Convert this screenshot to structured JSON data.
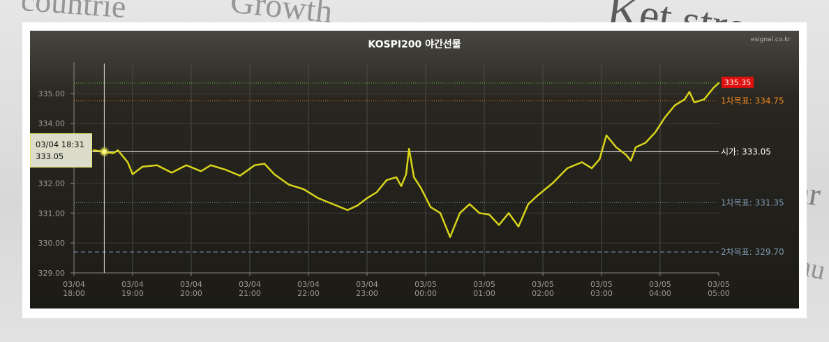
{
  "background_words": [
    "countrie",
    "Growth",
    "Ket stre",
    "ar",
    "au"
  ],
  "title": "KOSPI200 야간선물",
  "source": "esignal.co.kr",
  "tooltip": {
    "time": "03/04 18:31",
    "value": "333.05"
  },
  "chart_data": {
    "type": "line",
    "title": "KOSPI200 야간선물",
    "xlabel": "",
    "ylabel": "",
    "ylim": [
      329,
      336
    ],
    "yticks": [
      "335.00",
      "334.00",
      "333.00",
      "332.00",
      "331.00",
      "330.00",
      "329.00"
    ],
    "xlim": [
      "03/04 18:00",
      "03/05 05:00"
    ],
    "xticks": [
      {
        "date": "03/04",
        "time": "18:00"
      },
      {
        "date": "03/04",
        "time": "19:00"
      },
      {
        "date": "03/04",
        "time": "20:00"
      },
      {
        "date": "03/04",
        "time": "21:00"
      },
      {
        "date": "03/04",
        "time": "22:00"
      },
      {
        "date": "03/04",
        "time": "23:00"
      },
      {
        "date": "03/05",
        "time": "00:00"
      },
      {
        "date": "03/05",
        "time": "01:00"
      },
      {
        "date": "03/05",
        "time": "02:00"
      },
      {
        "date": "03/05",
        "time": "03:00"
      },
      {
        "date": "03/05",
        "time": "04:00"
      },
      {
        "date": "03/05",
        "time": "05:00"
      }
    ],
    "grid": true,
    "series": [
      {
        "color": "#d8d41a",
        "points": [
          [
            "03/04 18:20",
            333.1
          ],
          [
            "03/04 18:31",
            333.05
          ],
          [
            "03/04 18:40",
            333.0
          ],
          [
            "03/04 18:45",
            333.1
          ],
          [
            "03/04 18:55",
            332.7
          ],
          [
            "03/04 19:00",
            332.3
          ],
          [
            "03/04 19:10",
            332.55
          ],
          [
            "03/04 19:25",
            332.6
          ],
          [
            "03/04 19:40",
            332.35
          ],
          [
            "03/04 19:55",
            332.6
          ],
          [
            "03/04 20:10",
            332.4
          ],
          [
            "03/04 20:20",
            332.6
          ],
          [
            "03/04 20:35",
            332.45
          ],
          [
            "03/04 20:50",
            332.25
          ],
          [
            "03/04 21:05",
            332.6
          ],
          [
            "03/04 21:15",
            332.65
          ],
          [
            "03/04 21:25",
            332.3
          ],
          [
            "03/04 21:40",
            331.95
          ],
          [
            "03/04 21:55",
            331.8
          ],
          [
            "03/04 22:10",
            331.5
          ],
          [
            "03/04 22:25",
            331.3
          ],
          [
            "03/04 22:40",
            331.1
          ],
          [
            "03/04 22:50",
            331.25
          ],
          [
            "03/04 23:00",
            331.5
          ],
          [
            "03/04 23:10",
            331.7
          ],
          [
            "03/04 23:20",
            332.1
          ],
          [
            "03/04 23:30",
            332.2
          ],
          [
            "03/04 23:35",
            331.9
          ],
          [
            "03/04 23:40",
            332.3
          ],
          [
            "03/04 23:43",
            333.15
          ],
          [
            "03/04 23:48",
            332.2
          ],
          [
            "03/04 23:55",
            331.85
          ],
          [
            "03/05 00:05",
            331.2
          ],
          [
            "03/05 00:15",
            331.0
          ],
          [
            "03/05 00:25",
            330.2
          ],
          [
            "03/05 00:35",
            331.0
          ],
          [
            "03/05 00:45",
            331.3
          ],
          [
            "03/05 00:55",
            331.0
          ],
          [
            "03/05 01:05",
            330.95
          ],
          [
            "03/05 01:15",
            330.6
          ],
          [
            "03/05 01:25",
            331.0
          ],
          [
            "03/05 01:35",
            330.55
          ],
          [
            "03/05 01:45",
            331.3
          ],
          [
            "03/05 01:55",
            331.6
          ],
          [
            "03/05 02:10",
            332.0
          ],
          [
            "03/05 02:25",
            332.5
          ],
          [
            "03/05 02:40",
            332.7
          ],
          [
            "03/05 02:50",
            332.5
          ],
          [
            "03/05 02:58",
            332.8
          ],
          [
            "03/05 03:05",
            333.6
          ],
          [
            "03/05 03:15",
            333.2
          ],
          [
            "03/05 03:25",
            332.95
          ],
          [
            "03/05 03:30",
            332.75
          ],
          [
            "03/05 03:35",
            333.2
          ],
          [
            "03/05 03:45",
            333.35
          ],
          [
            "03/05 03:55",
            333.7
          ],
          [
            "03/05 04:05",
            334.2
          ],
          [
            "03/05 04:15",
            334.6
          ],
          [
            "03/05 04:25",
            334.8
          ],
          [
            "03/05 04:30",
            335.05
          ],
          [
            "03/05 04:35",
            334.7
          ],
          [
            "03/05 04:45",
            334.8
          ],
          [
            "03/05 04:55",
            335.2
          ],
          [
            "03/05 05:00",
            335.35
          ]
        ]
      }
    ],
    "reference_lines": [
      {
        "label": "1차목표",
        "value": 334.75,
        "value_text": "334.75",
        "color": "#f08a2a",
        "style": "dotted"
      },
      {
        "label": "시가",
        "value": 333.05,
        "value_text": "333.05",
        "color": "#ffffff",
        "style": "solid"
      },
      {
        "label": "1차목표",
        "value": 331.35,
        "value_text": "331.35",
        "color": "#7e9bb5",
        "style": "dotted"
      },
      {
        "label": "2차목표",
        "value": 329.7,
        "value_text": "329.70",
        "color": "#7e9bb5",
        "style": "dashed"
      },
      {
        "value": 335.35,
        "color": "#57c23b",
        "style": "dotted"
      }
    ],
    "last_price": {
      "value": 335.35,
      "text": "335.35",
      "color": "#e01010"
    },
    "crosshair_time": "03/04 18:31"
  }
}
